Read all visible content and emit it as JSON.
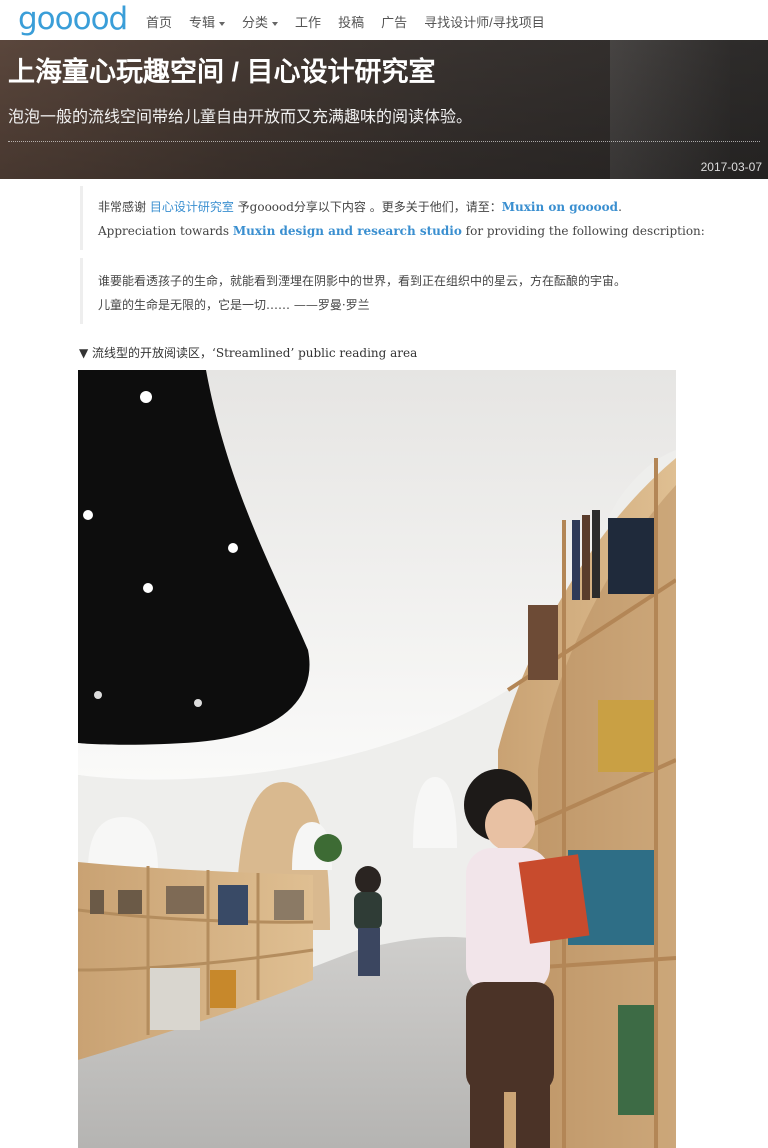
{
  "nav": {
    "logo": "gooood",
    "items": [
      "首页",
      "专辑",
      "分类",
      "工作",
      "投稿",
      "广告",
      "寻找设计师/寻找项目"
    ]
  },
  "header": {
    "title": "上海童心玩趣空间 / 目心设计研究室",
    "subtitle": "泡泡一般的流线空间带给儿童自由开放而又充满趣味的阅读体验。",
    "date": "2017-03-07"
  },
  "credits": {
    "cn_prefix": "非常感谢 ",
    "cn_link": "目心设计研究室",
    "cn_mid": " 予gooood分享以下内容 。更多关于他们，请至：",
    "cn_link2": "Muxin on gooood",
    "cn_end": ".",
    "en_prefix": "Appreciation towards ",
    "en_link": "Muxin design and research studio",
    "en_suffix": " for providing the following description:"
  },
  "quote": {
    "line1": "谁要能看透孩子的生命，就能看到湮埋在阴影中的世界，看到正在组织中的星云，方在酝酿的宇宙。",
    "line2": "儿童的生命是无限的，它是一切…… ——罗曼·罗兰"
  },
  "caption": "▼ 流线型的开放阅读区，‘Streamlined’ public reading area",
  "colors": {
    "accent": "#3a9ed8",
    "link": "#3a8fd0",
    "banner": "#3b3532"
  }
}
